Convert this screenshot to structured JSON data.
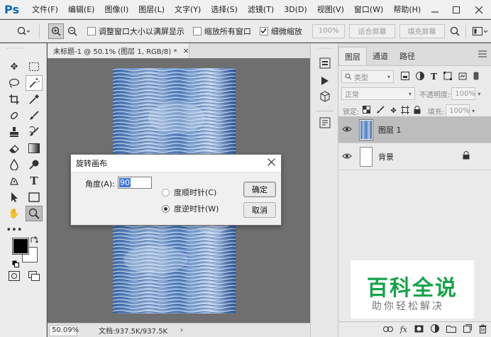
{
  "app": {
    "logo": "Ps",
    "menu": [
      "文件(F)",
      "编辑(E)",
      "图像(I)",
      "图层(L)",
      "文字(Y)",
      "选择(S)",
      "滤镜(T)",
      "3D(D)",
      "视图(V)",
      "窗口(W)",
      "帮助(H)"
    ]
  },
  "options": {
    "resize_windows": "调整窗口大小以满屏显示",
    "zoom_all": "缩放所有窗口",
    "scrubby_zoom": "细微缩放",
    "btn_100": "100%",
    "btn_fit": "适合屏幕",
    "btn_fill": "填充屏幕"
  },
  "document": {
    "tab_title": "未标题-1 @ 50.1% (图层 1, RGB/8) *",
    "status_zoom": "50.09%",
    "status_doc": "文档:937.5K/937.5K"
  },
  "layers_panel": {
    "tabs": [
      "图层",
      "通道",
      "路径"
    ],
    "filter_kind": "类型",
    "blend_mode": "正常",
    "opacity_label": "不透明度:",
    "opacity_value": "100%",
    "lock_label": "锁定:",
    "fill_label": "填充:",
    "fill_value": "100%",
    "layers": [
      {
        "name": "图层 1"
      },
      {
        "name": "背景"
      }
    ]
  },
  "dialog": {
    "title": "旋转画布",
    "angle_label": "角度(A):",
    "angle_value": "90",
    "cw_label": "度顺时针(C)",
    "ccw_label": "度逆时针(W)",
    "ok_label": "确定",
    "cancel_label": "取消",
    "selected": "ccw"
  },
  "watermark": {
    "title": "百科全说",
    "subtitle": "助你轻松解决"
  },
  "colors": {
    "accent_blue": "#0a6ab5",
    "watermark_green": "#16a34a"
  }
}
